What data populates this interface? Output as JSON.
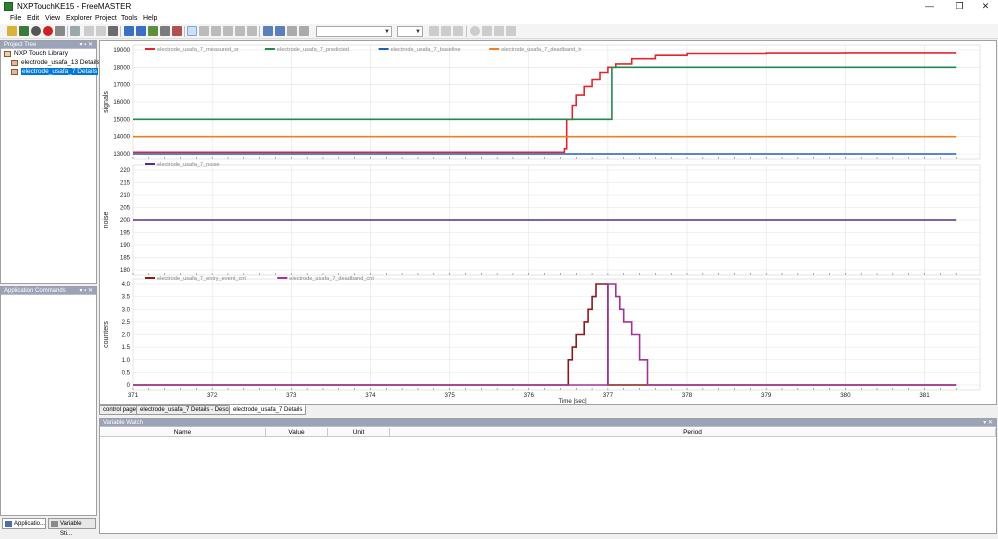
{
  "window": {
    "title": "NXPTouchKE15 - FreeMASTER",
    "minimize": "—",
    "maximize": "❐",
    "close": "✕"
  },
  "menu": [
    "File",
    "Edit",
    "View",
    "Explorer",
    "Project",
    "Tools",
    "Help"
  ],
  "colors": {
    "measured": "#e3262e",
    "predicted": "#1f8a4c",
    "baseline": "#1f5fbf",
    "deadband_h": "#f07f1e",
    "noise": "#5b2d8a",
    "entry_event": "#8b1a1a",
    "deadband_cnt": "#a0329a",
    "panel_header": "#d6dbe9",
    "selection": "#0078d7"
  },
  "project_tree": {
    "header": "Project Tree",
    "root": "NXP Touch Library",
    "items": [
      "electrode_usafa_13 Details",
      "electrode_usafa_7 Details"
    ],
    "selected_index": 1
  },
  "app_commands": {
    "header": "Application Commands"
  },
  "left_tabs": [
    "Applicatio...",
    "Variable Sti..."
  ],
  "document_tabs": [
    "control page",
    "electrode_usafa_7 Details - Description",
    "electrode_usafa_7 Details"
  ],
  "active_tab_index": 2,
  "variable_watch": {
    "header": "Variable Watch",
    "columns": [
      "Name",
      "Value",
      "Unit",
      "Period"
    ]
  },
  "chart_data": [
    {
      "type": "line",
      "ylabel": "signals",
      "ylim": [
        13000,
        19000
      ],
      "yticks": [
        13000,
        14000,
        15000,
        16000,
        17000,
        18000,
        19000
      ],
      "series": [
        {
          "name": "electrode_usafa_7_measured_sr",
          "color": "#e3262e",
          "x": [
            371.0,
            376.3,
            376.45,
            376.48,
            376.55,
            376.6,
            376.7,
            376.8,
            376.9,
            377.0,
            377.1,
            377.3,
            377.6,
            378.0,
            379.0,
            380.0,
            381.4
          ],
          "y": [
            13100,
            13100,
            13300,
            15000,
            15800,
            16400,
            16900,
            17300,
            17700,
            18000,
            18200,
            18500,
            18700,
            18800,
            18820,
            18830,
            18830
          ]
        },
        {
          "name": "electrode_usafa_7_predicted",
          "color": "#1f8a4c",
          "x": [
            371.0,
            377.0,
            377.05,
            381.4
          ],
          "y": [
            15000,
            15000,
            18000,
            18000
          ]
        },
        {
          "name": "electrode_usafa_7_baseline",
          "color": "#1f5fbf",
          "x": [
            371.0,
            381.4
          ],
          "y": [
            13000,
            13000
          ]
        },
        {
          "name": "electrode_usafa_7_deadband_h",
          "color": "#f07f1e",
          "x": [
            371.0,
            381.4
          ],
          "y": [
            14000,
            14000
          ]
        }
      ]
    },
    {
      "type": "line",
      "ylabel": "noise",
      "ylim": [
        180,
        220
      ],
      "yticks": [
        180,
        185,
        190,
        195,
        200,
        205,
        210,
        215,
        220
      ],
      "series": [
        {
          "name": "electrode_usafa_7_noise",
          "color": "#5b2d8a",
          "x": [
            371.0,
            381.4
          ],
          "y": [
            200,
            200
          ]
        }
      ]
    },
    {
      "type": "line",
      "ylabel": "counters",
      "xlabel": "Time [sec]",
      "ylim": [
        0,
        4
      ],
      "yticks": [
        "0",
        "0.5",
        "1.0",
        "1.5",
        "2.0",
        "2.5",
        "3.0",
        "3.5",
        "4.0"
      ],
      "xlim": [
        371,
        381.6
      ],
      "xticks": [
        371,
        372,
        373,
        374,
        375,
        376,
        377,
        378,
        379,
        380,
        381
      ],
      "series": [
        {
          "name": "electrode_usafa_7_entry_event_cnt",
          "color": "#8b1a1a",
          "x": [
            371.0,
            376.45,
            376.5,
            376.55,
            376.6,
            376.7,
            376.75,
            376.8,
            376.85,
            376.9,
            376.95,
            377.0,
            381.4
          ],
          "y": [
            0,
            0,
            1,
            1.5,
            2,
            2.5,
            3,
            3.5,
            4,
            4,
            4,
            0,
            0
          ]
        },
        {
          "name": "electrode_usafa_7_deadband_cnt",
          "color": "#a0329a",
          "x": [
            371.0,
            376.95,
            377.0,
            377.05,
            377.1,
            377.15,
            377.2,
            377.3,
            377.4,
            377.5,
            381.4
          ],
          "y": [
            0,
            0,
            4,
            4,
            3.5,
            3,
            2.5,
            2,
            1,
            0,
            0
          ]
        }
      ]
    }
  ]
}
